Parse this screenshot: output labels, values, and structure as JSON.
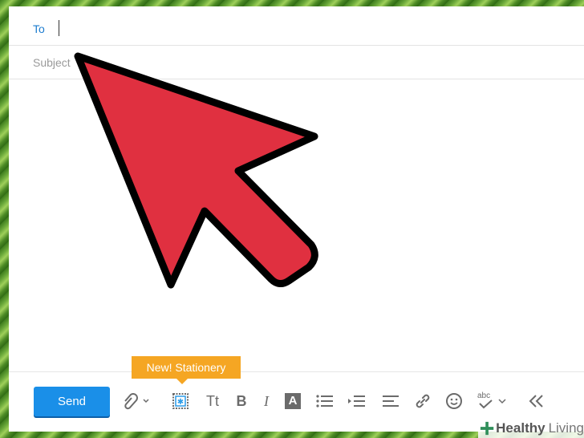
{
  "compose": {
    "to_label": "To",
    "subject_label": "Subject"
  },
  "toolbar": {
    "send_label": "Send",
    "tooltip": "New! Stationery",
    "text_size_label": "Tt",
    "bold_label": "B",
    "italic_label": "I",
    "color_label": "A",
    "spell_label": "abc"
  },
  "icons": [
    "paperclip-icon",
    "stationery-icon",
    "text-size-icon",
    "bold-icon",
    "italic-icon",
    "text-color-icon",
    "bullet-list-icon",
    "indent-icon",
    "align-left-icon",
    "link-icon",
    "emoji-icon",
    "spellcheck-icon",
    "collapse-icon",
    "cursor-arrow-icon"
  ],
  "watermark": {
    "part1": "Healthy",
    "part2": "Living"
  },
  "colors": {
    "accent": "#1a8fe8",
    "tooltip": "#f5a623",
    "cursor_fill": "#e03040"
  }
}
